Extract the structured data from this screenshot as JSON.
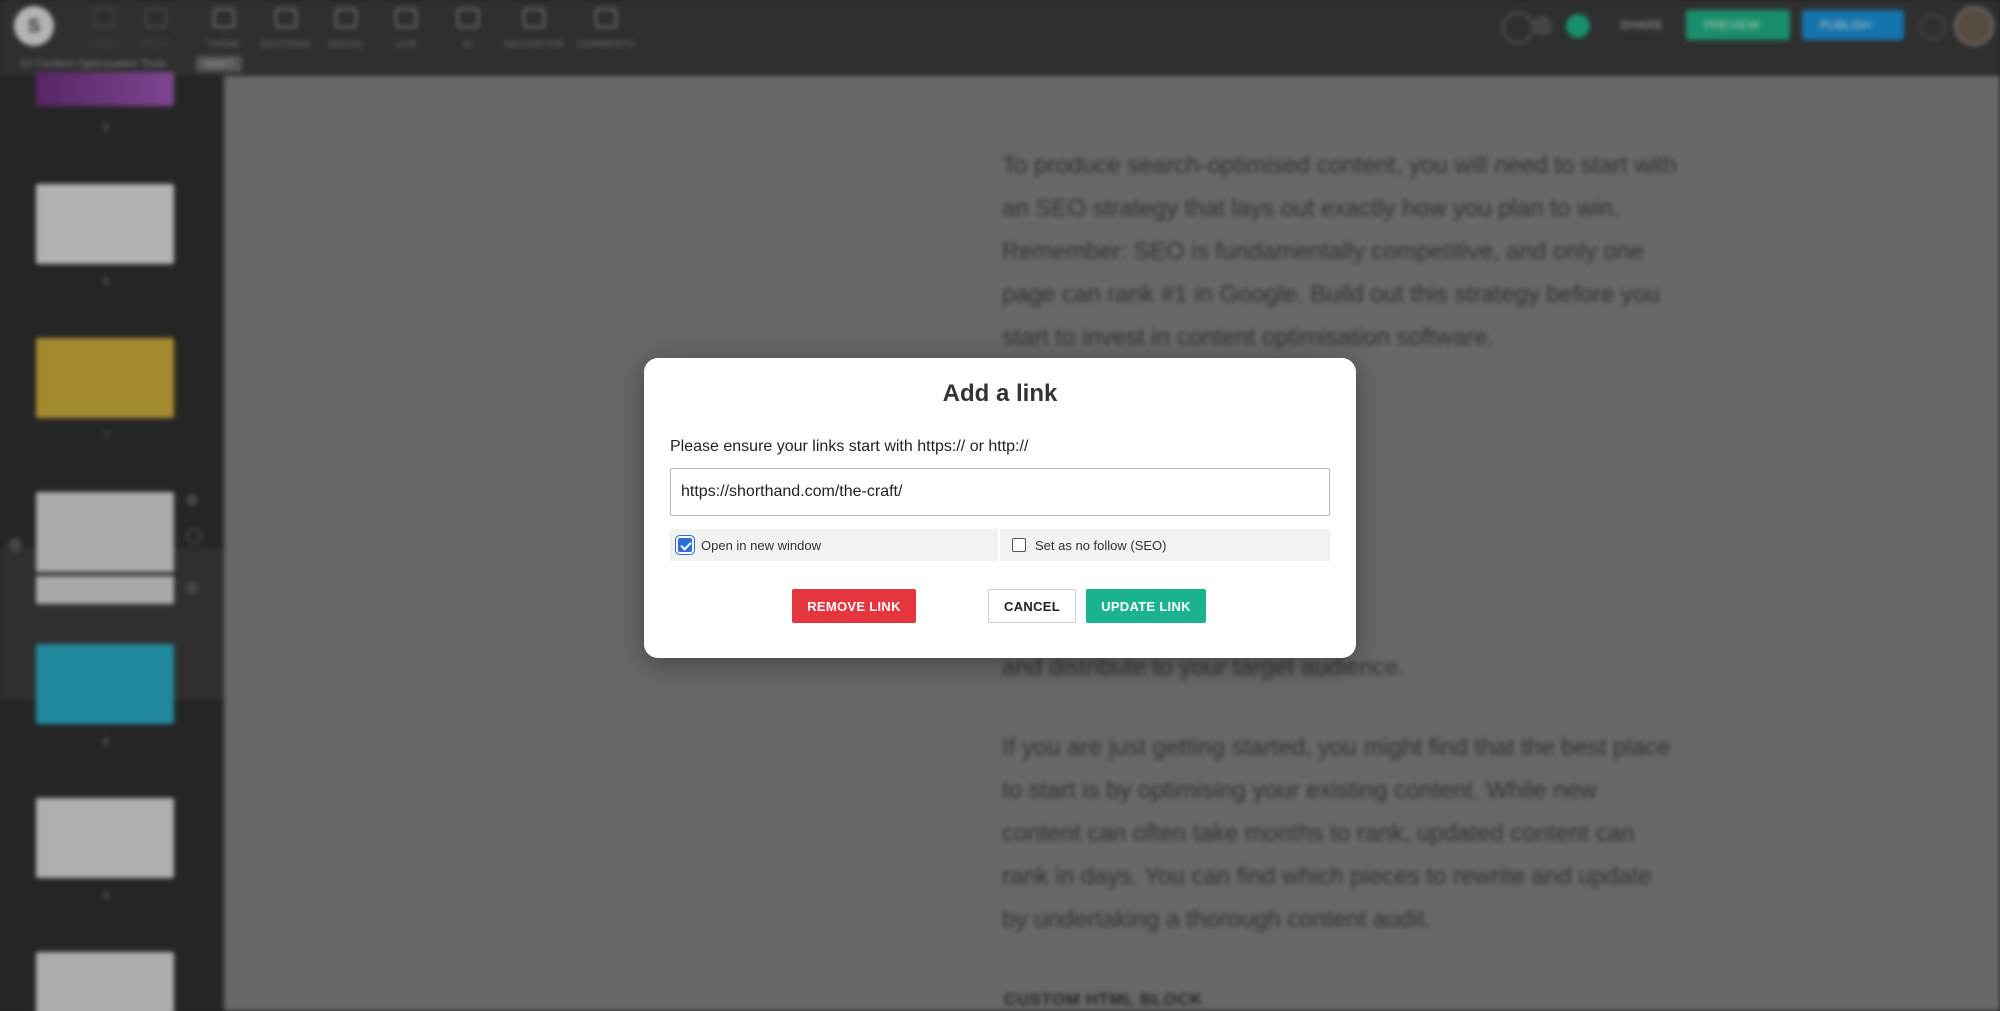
{
  "toolbar": {
    "logo_letter": "S",
    "tools": [
      {
        "label": "UNDO",
        "icon": "undo-icon"
      },
      {
        "label": "REDO",
        "icon": "redo-icon"
      },
      {
        "label": "THEME",
        "icon": "brush-icon"
      },
      {
        "label": "SECTIONS",
        "icon": "sections-icon"
      },
      {
        "label": "SOCIAL",
        "icon": "share-icon"
      },
      {
        "label": "LIVE",
        "icon": "live-icon"
      },
      {
        "label": "AI",
        "icon": "ai-icon"
      },
      {
        "label": "NAVIGATION",
        "icon": "navigation-icon"
      },
      {
        "label": "COMMENTS",
        "icon": "comments-icon"
      }
    ],
    "share_label": "SHARE",
    "preview_label": "PREVIEW",
    "publish_label": "PUBLISH"
  },
  "breadcrumb": {
    "title": "10 Content Optimisation Tools",
    "tag": "DRAFT"
  },
  "sidebar": {
    "numbers": [
      "5",
      "6",
      "7",
      "8",
      "9",
      "10"
    ]
  },
  "content": {
    "paragraphs": [
      "To produce search-optimised content, you will need to start with an SEO strategy that lays out exactly how you plan to win. Remember: SEO is fundamentally competitive, and only one page can rank #1 in Google. Build out this strategy before you start to invest in content optimisation software.",
      "If you are just getting started, you might find that the best place to start is by optimising your existing content. While new content can often take months to rank, updated content can rank in days. You can find which pieces to rewrite and update by undertaking a thorough content audit."
    ],
    "tail_line": "and distribute to your target audience.",
    "html_block_label": "CUSTOM HTML BLOCK"
  },
  "modal": {
    "title": "Add a link",
    "hint": "Please ensure your links start with https:// or http://",
    "url_value": "https://shorthand.com/the-craft/",
    "open_new_window_label": "Open in new window",
    "open_new_window_checked": true,
    "nofollow_label": "Set as no follow (SEO)",
    "nofollow_checked": false,
    "remove_label": "REMOVE LINK",
    "cancel_label": "CANCEL",
    "update_label": "UPDATE LINK"
  },
  "colors": {
    "remove": "#e5353f",
    "update": "#1bb38f",
    "preview": "#1fae84",
    "publish": "#1a8ed1",
    "checkbox": "#2b6fd6"
  }
}
